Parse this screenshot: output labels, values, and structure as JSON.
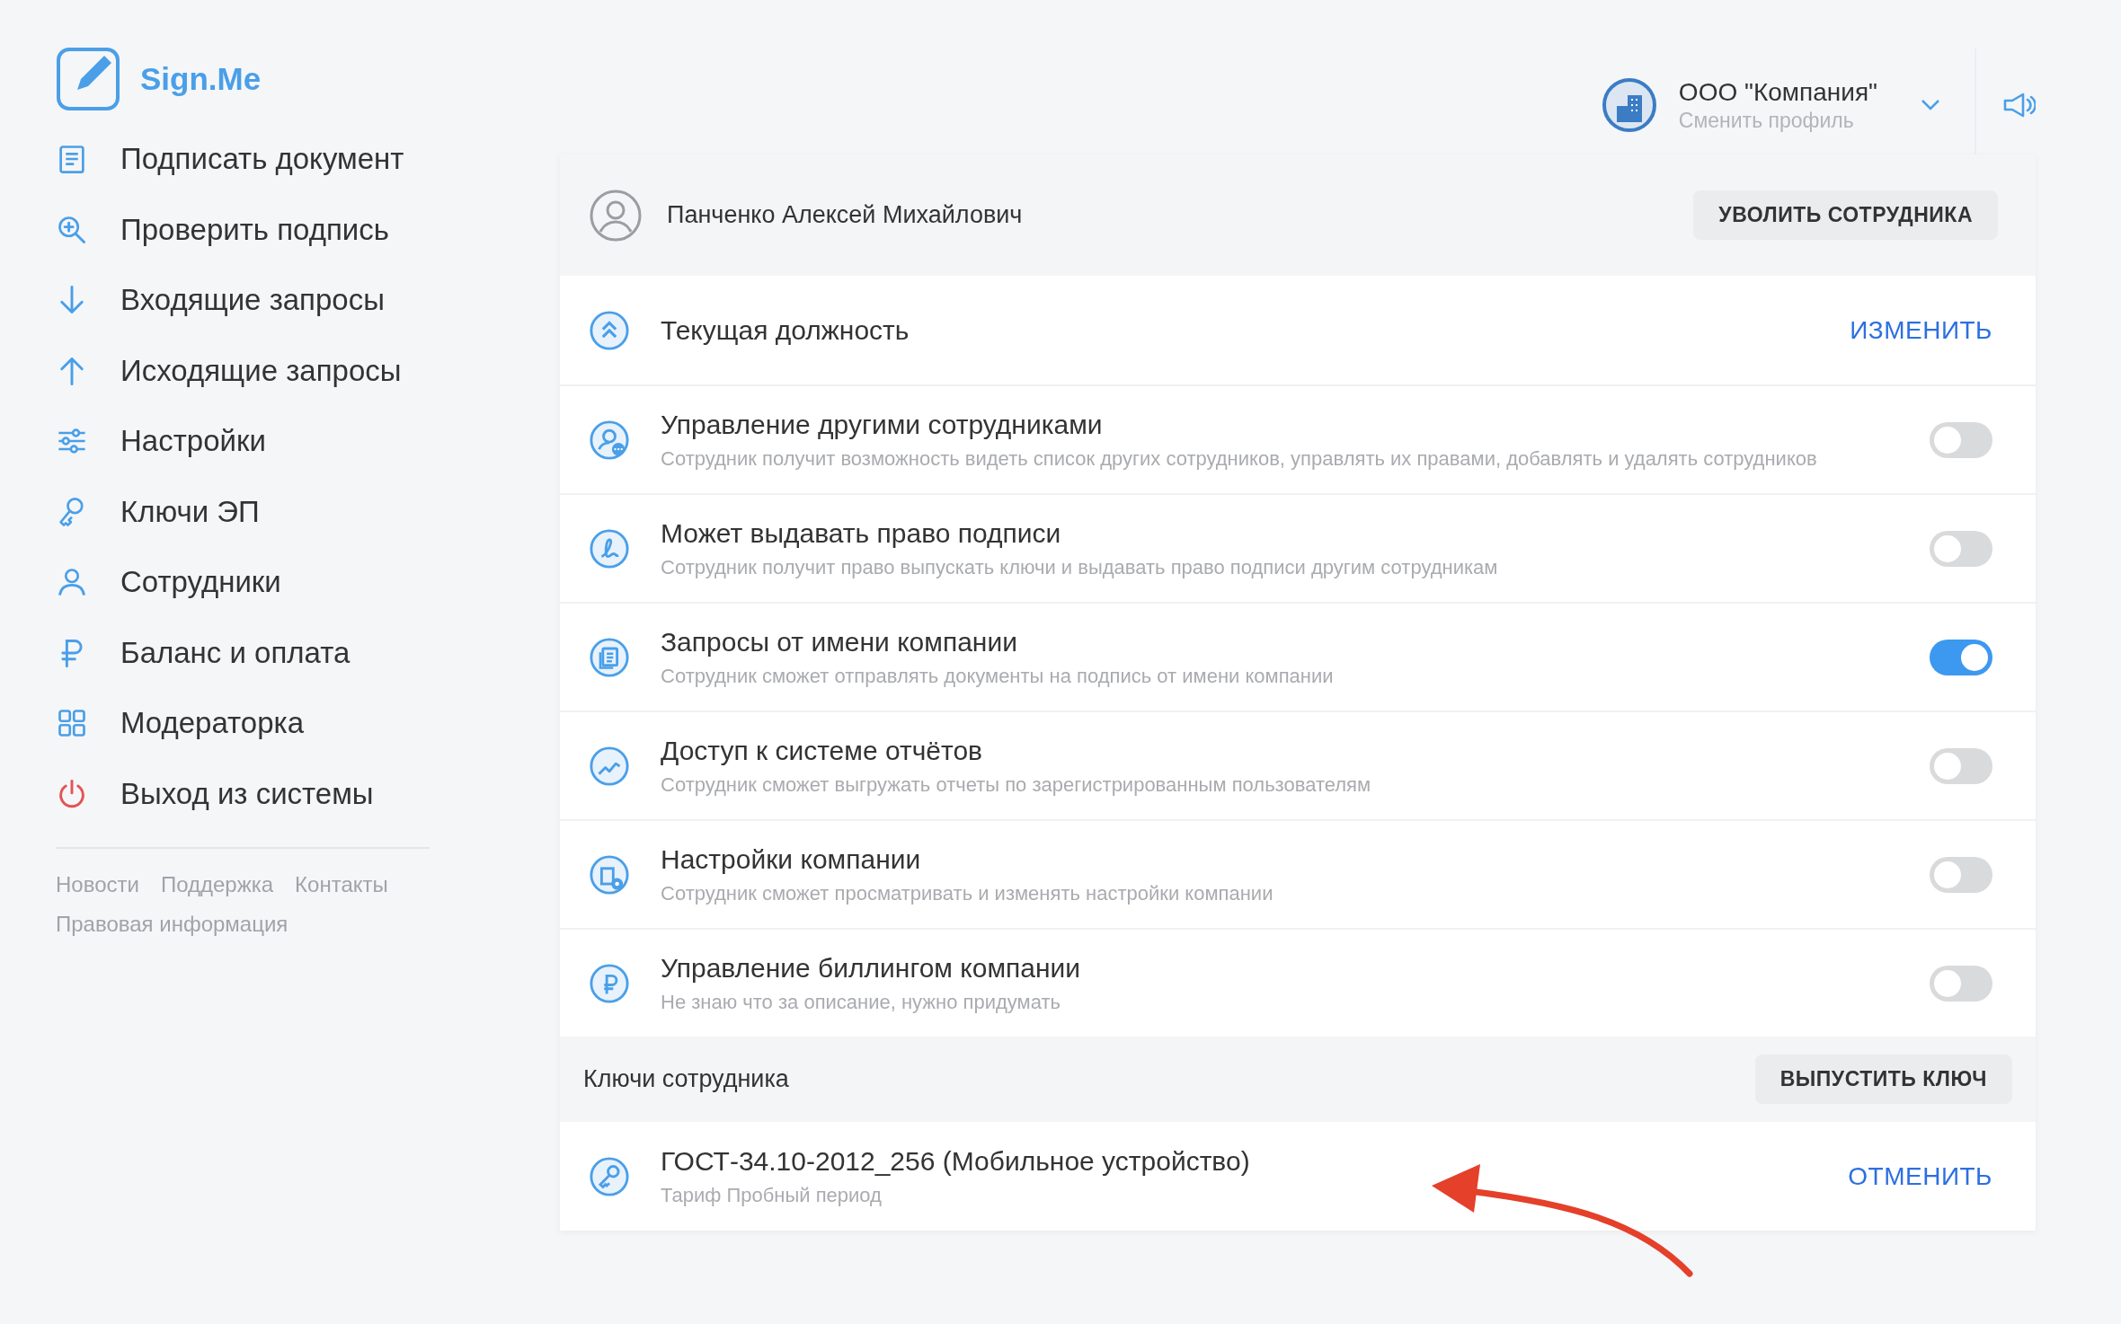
{
  "logo": {
    "text": "Sign.Me"
  },
  "nav": [
    {
      "label": "Подписать документ"
    },
    {
      "label": "Проверить подпись"
    },
    {
      "label": "Входящие запросы"
    },
    {
      "label": "Исходящие запросы"
    },
    {
      "label": "Настройки"
    },
    {
      "label": "Ключи ЭП"
    },
    {
      "label": "Сотрудники"
    },
    {
      "label": "Баланс и оплата"
    },
    {
      "label": "Модераторка"
    },
    {
      "label": "Выход из системы",
      "kind": "danger"
    }
  ],
  "footer_links": [
    "Новости",
    "Поддержка",
    "Контакты",
    "Правовая информация"
  ],
  "profile": {
    "name": "ООО \"Компания\"",
    "subtitle": "Сменить профиль"
  },
  "employee": {
    "name": "Панченко Алексей Михайлович",
    "fire_button": "УВОЛИТЬ СОТРУДНИКА"
  },
  "position": {
    "label": "Текущая должность",
    "action": "ИЗМЕНИТЬ"
  },
  "permissions": [
    {
      "title": "Управление другими сотрудниками",
      "description": "Сотрудник получит возможность видеть список других сотрудников, управлять их правами, добавлять и удалять сотрудников",
      "on": false
    },
    {
      "title": "Может выдавать право подписи",
      "description": "Сотрудник получит право выпускать ключи и выдавать право подписи другим сотрудникам",
      "on": false
    },
    {
      "title": "Запросы от имени компании",
      "description": "Сотрудник сможет отправлять документы на подпись от имени компании",
      "on": true
    },
    {
      "title": "Доступ к системе отчётов",
      "description": "Сотрудник сможет выгружать отчеты по зарегистрированным пользователям",
      "on": false
    },
    {
      "title": "Настройки компании",
      "description": "Сотрудник сможет просматривать и изменять настройки компании",
      "on": false
    },
    {
      "title": "Управление биллингом компании",
      "description": "Не знаю что за описание, нужно придумать",
      "on": false
    }
  ],
  "keys": {
    "title": "Ключи сотрудника",
    "issue_button": "ВЫПУСТИТЬ КЛЮЧ",
    "items": [
      {
        "name": "ГОСТ-34.10-2012_256 (Мобильное устройство)",
        "subtitle": "Тариф Пробный период",
        "action": "ОТМЕНИТЬ"
      }
    ]
  }
}
